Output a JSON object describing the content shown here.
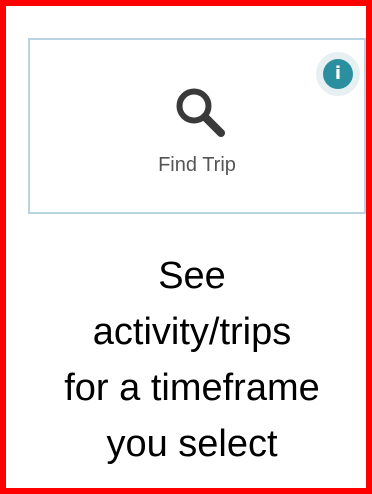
{
  "tile": {
    "label": "Find Trip",
    "icon": "search-icon",
    "info_icon": "info-icon",
    "info_glyph": "i",
    "border_color": "#b9d3e0",
    "info_color": "#2b8f9f"
  },
  "caption": {
    "lines": [
      "See",
      "activity/trips",
      "for a timeframe",
      "you select"
    ]
  },
  "colors": {
    "frame_border": "#ff0000",
    "icon_color": "#3a3a3a"
  }
}
